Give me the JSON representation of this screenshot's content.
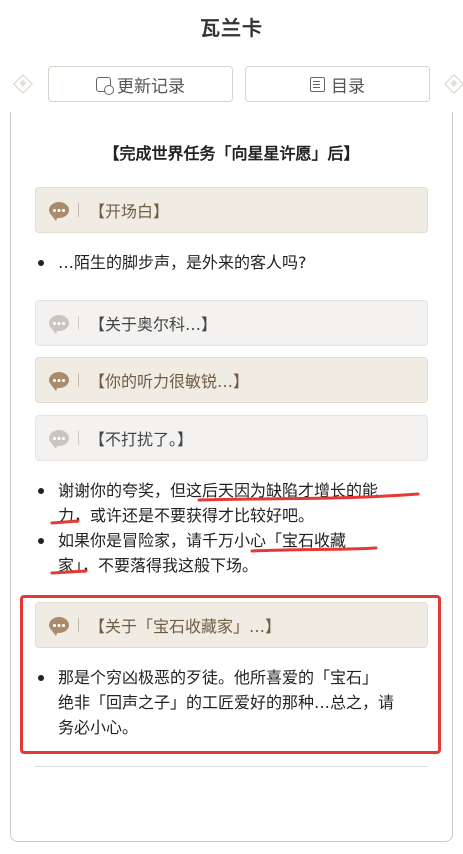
{
  "page": {
    "title": "瓦兰卡"
  },
  "tabs": {
    "changelog": "更新记录",
    "toc": "目录"
  },
  "section": {
    "heading": "【完成世界任务「向星星许愿」后】"
  },
  "dialogue": {
    "opener": "【开场白】",
    "opener_line": "…陌生的脚步声，是外来的客人吗?",
    "option1": "【关于奥尔科…】",
    "option2": "【你的听力很敏锐…】",
    "option3": "【不打扰了。】",
    "reply1_a": "谢谢你的夸奖，但这后天因为缺陷才增长的能",
    "reply1_b": "力，或许还是不要获得才比较好吧。",
    "reply2_a": "如果你是冒险家，请千万小心「宝石收藏",
    "reply2_b": "家」，不要落得我这般下场。",
    "option4": "【关于「宝石收藏家」…】",
    "reply3_a": "那是个穷凶极恶的歹徒。他所喜爱的「宝石」",
    "reply3_b": "绝非「回声之子」的工匠爱好的那种…总之，请",
    "reply3_c": "务必小心。"
  },
  "icons": {
    "changelog": "changelog-icon",
    "toc": "document-icon",
    "dialogue": "speech-bubble-icon"
  },
  "colors": {
    "annotation": "#e53935",
    "dialogue_tan_bg": "#f1ece3",
    "dialogue_grey_bg": "#f3f2f1"
  }
}
